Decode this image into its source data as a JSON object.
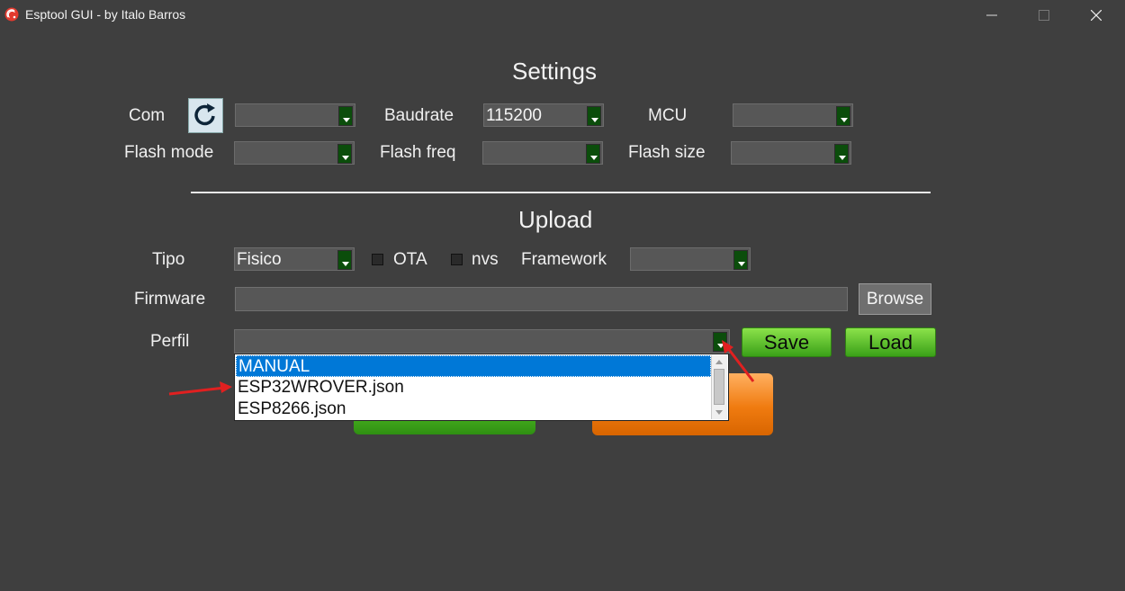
{
  "window": {
    "title": "Esptool GUI - by Italo Barros",
    "app_icon": "espressif-logo-icon",
    "controls": [
      "minimize-icon",
      "maximize-icon",
      "close-icon"
    ]
  },
  "settings": {
    "title": "Settings",
    "com_label": "Com",
    "com_value": "",
    "refresh_icon": "refresh-icon",
    "baudrate_label": "Baudrate",
    "baudrate_value": "115200",
    "mcu_label": "MCU",
    "mcu_value": "",
    "flash_mode_label": "Flash mode",
    "flash_mode_value": "",
    "flash_freq_label": "Flash freq",
    "flash_freq_value": "",
    "flash_size_label": "Flash size",
    "flash_size_value": ""
  },
  "upload": {
    "title": "Upload",
    "tipo_label": "Tipo",
    "tipo_value": "Fisico",
    "ota_label": "OTA",
    "ota_checked": false,
    "nvs_label": "nvs",
    "nvs_checked": false,
    "framework_label": "Framework",
    "framework_value": "",
    "firmware_label": "Firmware",
    "firmware_value": "",
    "browse_label": "Browse",
    "perfil_label": "Perfil",
    "perfil_value": "",
    "save_label": "Save",
    "load_label": "Load",
    "perfil_options": [
      "MANUAL",
      "ESP32WROVER.json",
      "ESP8266.json"
    ],
    "perfil_highlighted": "MANUAL"
  },
  "colors": {
    "background": "#3f3f3f",
    "combo_arrow": "#0b4d0b",
    "button_green": "#4cb423",
    "button_orange": "#f07b10",
    "selection_blue": "#0078d7",
    "annotation_red": "#e02020"
  }
}
